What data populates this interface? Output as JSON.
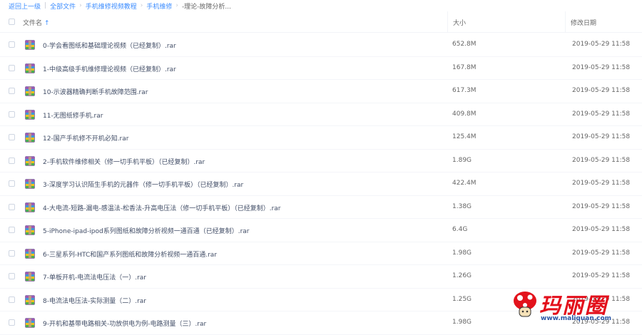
{
  "breadcrumb": {
    "back": "返回上一级",
    "all_files": "全部文件",
    "level1": "手机维修视频教程",
    "level2": "手机维修",
    "current": "-理论-故障分析..."
  },
  "header": {
    "name_label": "文件名",
    "sort_arrow": "↑",
    "size_label": "大小",
    "date_label": "修改日期"
  },
  "files": [
    {
      "name": "0-学会看图纸和基础理论视频（已经复制）.rar",
      "size": "652.8M",
      "date": "2019-05-29 11:58",
      "icon": "rar-archive-icon"
    },
    {
      "name": "1-中级高级手机维修理论视频（已经复制）.rar",
      "size": "167.8M",
      "date": "2019-05-29 11:58",
      "icon": "rar-archive-icon"
    },
    {
      "name": "10-示波器精确判断手机故障范围.rar",
      "size": "617.3M",
      "date": "2019-05-29 11:58",
      "icon": "rar-archive-icon"
    },
    {
      "name": "11-无图纸修手机.rar",
      "size": "409.8M",
      "date": "2019-05-29 11:58",
      "icon": "rar-archive-icon"
    },
    {
      "name": "12-国产手机修不开机必知.rar",
      "size": "125.4M",
      "date": "2019-05-29 11:58",
      "icon": "rar-archive-icon"
    },
    {
      "name": "2-手机软件维修相关（修一切手机平板）（已经复制）.rar",
      "size": "1.89G",
      "date": "2019-05-29 11:58",
      "icon": "rar-archive-icon"
    },
    {
      "name": "3-深度学习认识陌生手机的元器件（修一切手机平板）（已经复制）.rar",
      "size": "422.4M",
      "date": "2019-05-29 11:58",
      "icon": "rar-archive-icon"
    },
    {
      "name": "4-大电流-短路-漏电-感温法-松香法-升高电压法（修一切手机平板）（已经复制）.rar",
      "size": "1.38G",
      "date": "2019-05-29 11:58",
      "icon": "rar-archive-icon"
    },
    {
      "name": "5-iPhone-ipad-ipod系列图纸和故障分析视频一通百通（已经复制）.rar",
      "size": "6.4G",
      "date": "2019-05-29 11:58",
      "icon": "rar-archive-icon"
    },
    {
      "name": "6-三星系列-HTC和国产系列图纸和故障分析视频一通百通.rar",
      "size": "1.98G",
      "date": "2019-05-29 11:58",
      "icon": "rar-archive-icon"
    },
    {
      "name": "7-单板开机-电流法电压法（一）.rar",
      "size": "1.26G",
      "date": "2019-05-29 11:58",
      "icon": "rar-archive-icon"
    },
    {
      "name": "8-电流法电压法-实际测量（二）.rar",
      "size": "1.25G",
      "date": "2019-05-29 11:58",
      "icon": "rar-archive-icon"
    },
    {
      "name": "9-开机和基带电路相关-功放供电为例-电路测量（三）.rar",
      "size": "1.98G",
      "date": "2019-05-29 11:58",
      "icon": "rar-archive-icon"
    }
  ],
  "watermark": {
    "title": "玛丽圈",
    "url": "www.maliquan.com"
  }
}
